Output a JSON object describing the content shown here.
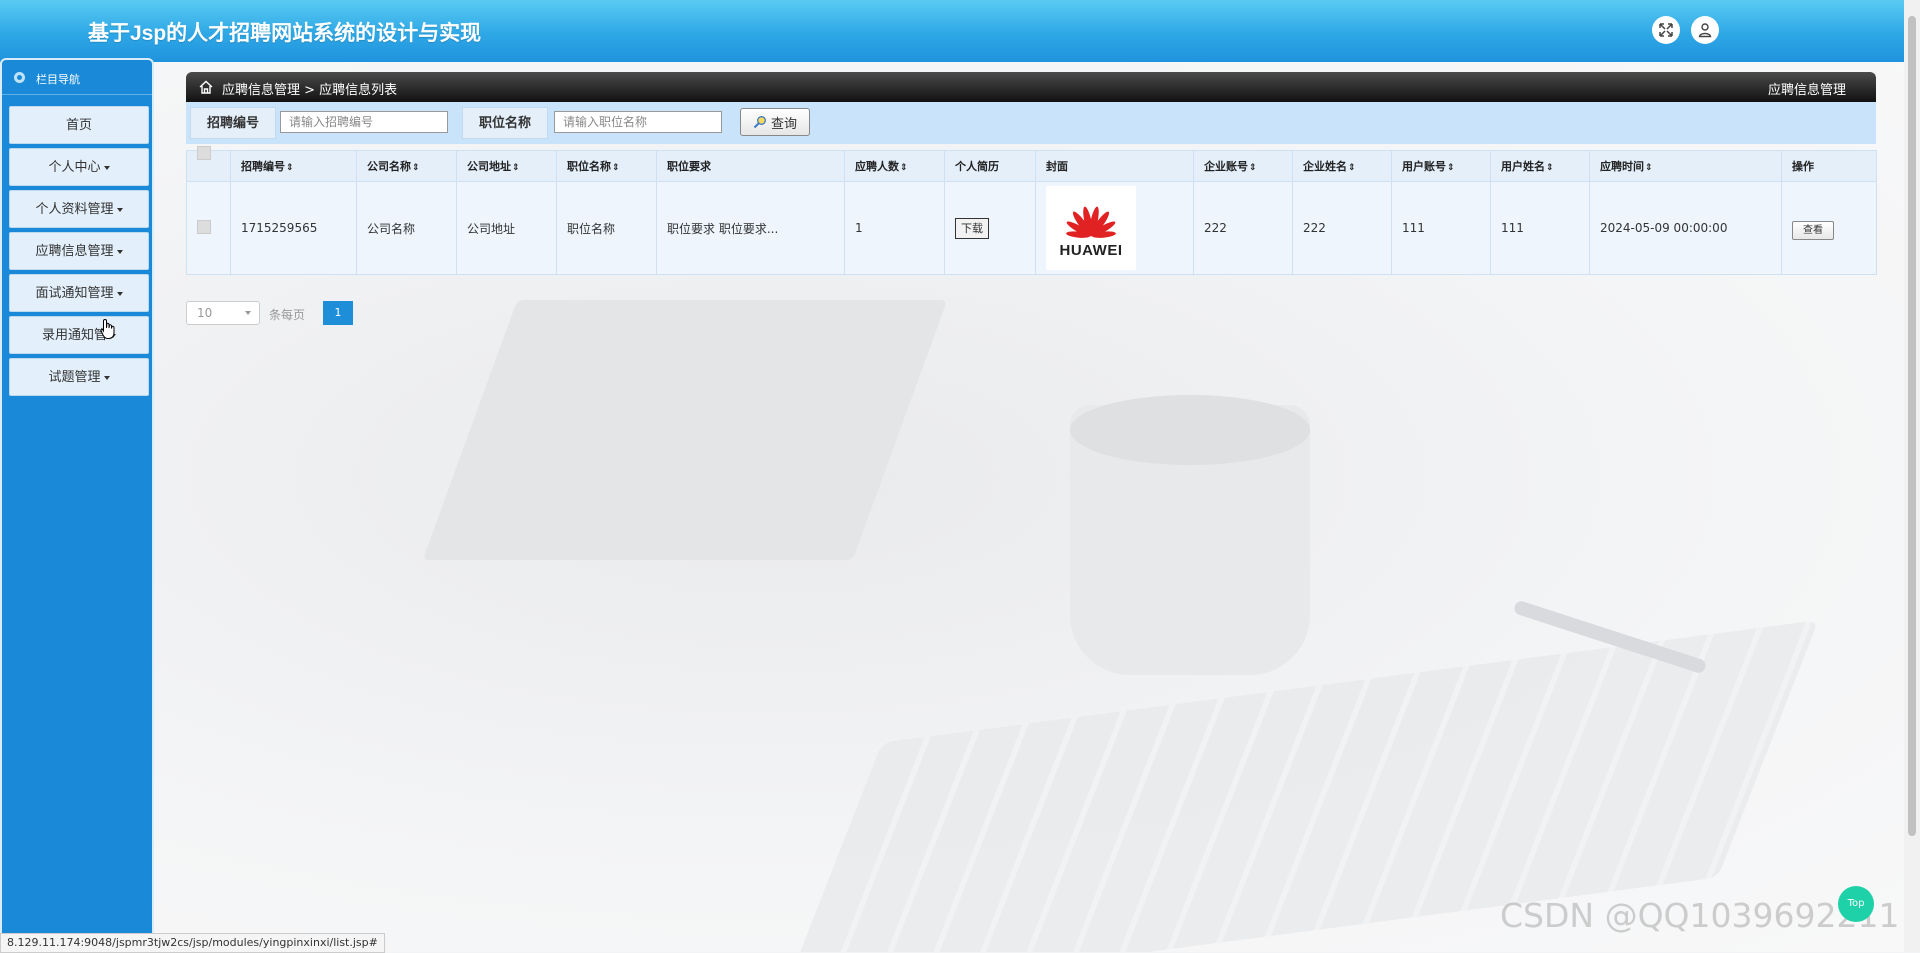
{
  "app": {
    "title": "基于Jsp的人才招聘网站系统的设计与实现"
  },
  "header": {
    "fullscreen_icon": "expand-icon",
    "user_icon": "user-icon"
  },
  "sidebar": {
    "heading": "栏目导航",
    "items": [
      {
        "label": "首页",
        "has_caret": false
      },
      {
        "label": "个人中心",
        "has_caret": true
      },
      {
        "label": "个人资料管理",
        "has_caret": true
      },
      {
        "label": "应聘信息管理",
        "has_caret": true
      },
      {
        "label": "面试通知管理",
        "has_caret": true
      },
      {
        "label": "录用通知管",
        "has_caret": true
      },
      {
        "label": "试题管理",
        "has_caret": true
      }
    ]
  },
  "breadcrumb": {
    "path": "应聘信息管理 > 应聘信息列表",
    "right": "应聘信息管理"
  },
  "search": {
    "field1_label": "招聘编号",
    "field1_placeholder": "请输入招聘编号",
    "field2_label": "职位名称",
    "field2_placeholder": "请输入职位名称",
    "button_label": "查询"
  },
  "table": {
    "columns": [
      "招聘编号",
      "公司名称",
      "公司地址",
      "职位名称",
      "职位要求",
      "应聘人数",
      "个人简历",
      "封面",
      "企业账号",
      "企业姓名",
      "用户账号",
      "用户姓名",
      "应聘时间",
      "操作"
    ],
    "sortable": [
      true,
      true,
      true,
      true,
      false,
      true,
      false,
      false,
      true,
      true,
      true,
      true,
      true,
      false
    ],
    "rows": [
      {
        "zhaopinbianhao": "1715259565",
        "gongsimingcheng": "公司名称",
        "gongsidizhi": "公司地址",
        "zhiweimingcheng": "职位名称",
        "zhiweiyaoqiu": "职位要求 职位要求...",
        "yingpinrenshu": "1",
        "resume_button": "下载",
        "cover_text": "HUAWEI",
        "qiyezhanghao": "222",
        "qiyexingming": "222",
        "yonghuzhanghao": "111",
        "yonghuxingming": "111",
        "yingpinshijian": "2024-05-09 00:00:00",
        "action_button": "查看"
      }
    ]
  },
  "pagination": {
    "page_size": "10",
    "page_size_label": "条每页",
    "current_page": "1"
  },
  "status_bar": {
    "url": "8.129.11.174:9048/jspmr3tjw2cs/jsp/modules/yingpinxinxi/list.jsp#"
  },
  "watermark": "CSDN @QQ1039692211",
  "back_to_top": "Top",
  "colors": {
    "header": "#2ea7e6",
    "sidebar": "#1a8ad8",
    "accent": "#1e8ed9",
    "top_button": "#1fd1a8"
  }
}
